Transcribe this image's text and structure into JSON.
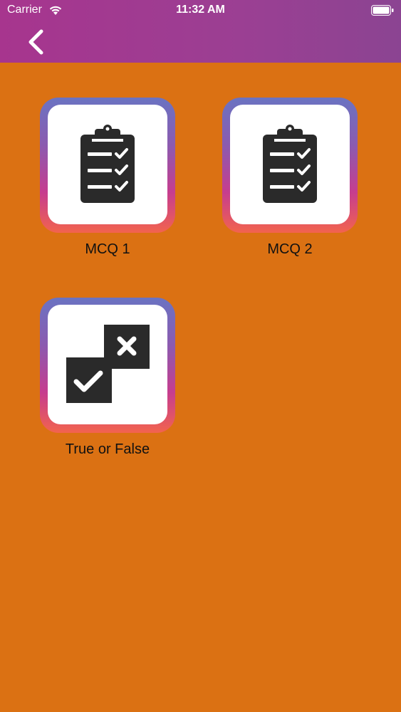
{
  "status_bar": {
    "carrier": "Carrier",
    "time": "11:32 AM"
  },
  "nav": {
    "back_icon": "chevron-left-icon"
  },
  "tiles": [
    {
      "label": "MCQ 1",
      "icon": "clipboard-checklist-icon"
    },
    {
      "label": "MCQ 2",
      "icon": "clipboard-checklist-icon"
    },
    {
      "label": "True or False",
      "icon": "true-false-icon"
    }
  ],
  "colors": {
    "background": "#DB7113",
    "header": "#A7358E",
    "icon": "#2A2A2A"
  }
}
